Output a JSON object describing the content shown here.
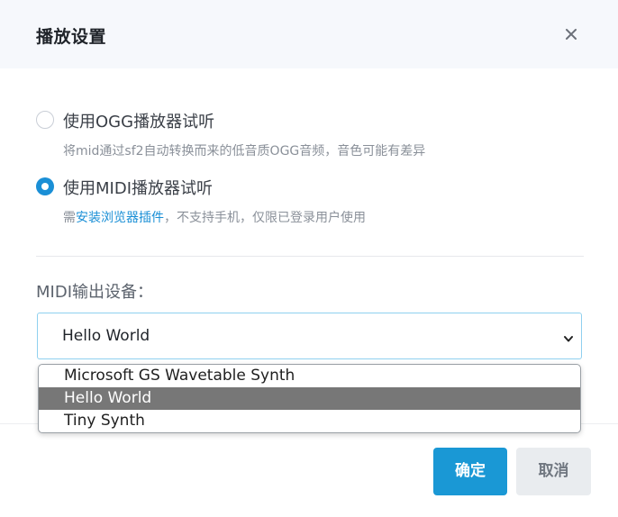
{
  "dialog": {
    "title": "播放设置",
    "close_icon": "close-icon"
  },
  "options": [
    {
      "label": "使用OGG播放器试听",
      "desc": "将mid通过sf2自动转换而来的低音质OGG音频，音色可能有差异",
      "checked": false
    },
    {
      "label": "使用MIDI播放器试听",
      "desc_prefix": "需",
      "desc_link": "安装浏览器插件",
      "desc_suffix": "，不支持手机，仅限已登录用户使用",
      "checked": true
    }
  ],
  "device": {
    "label": "MIDI输出设备：",
    "selected": "Hello World",
    "options": [
      "Microsoft GS Wavetable Synth",
      "Hello World",
      "Tiny Synth"
    ],
    "selected_index": 1
  },
  "buttons": {
    "ok": "确定",
    "cancel": "取消"
  },
  "colors": {
    "accent": "#1a98d5",
    "header_bg": "#f6f8fc",
    "dropdown_highlight": "#777777"
  }
}
